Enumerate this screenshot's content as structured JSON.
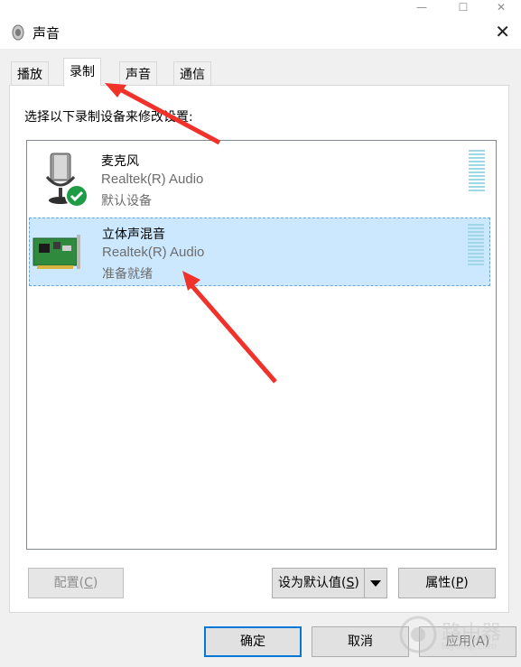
{
  "window": {
    "title": "声音",
    "controls": {
      "minimize": "—",
      "maximize": "☐",
      "close": "✕"
    }
  },
  "tabs": [
    {
      "label": "播放",
      "active": false
    },
    {
      "label": "录制",
      "active": true
    },
    {
      "label": "声音",
      "active": false
    },
    {
      "label": "通信",
      "active": false
    }
  ],
  "instruction": "选择以下录制设备来修改设置:",
  "devices": [
    {
      "name": "麦克风",
      "driver": "Realtek(R) Audio",
      "status": "默认设备",
      "icon": "microphone-icon",
      "badge": "check-icon",
      "selected": false
    },
    {
      "name": "立体声混音",
      "driver": "Realtek(R) Audio",
      "status": "准备就绪",
      "icon": "sound-card-icon",
      "selected": true
    }
  ],
  "buttons": {
    "configure": {
      "main": "配置(",
      "key": "C",
      "end": ")",
      "enabled": false
    },
    "set_default": {
      "main": "设为默认值(",
      "key": "S",
      "end": ")"
    },
    "properties": {
      "main": "属性(",
      "key": "P",
      "end": ")"
    },
    "ok": "确定",
    "cancel": "取消",
    "apply": "应用(A)"
  },
  "watermark": {
    "text": "路由器",
    "subtext": "luyouqi.com"
  },
  "colors": {
    "selection": "#cce8ff",
    "annotation_arrow": "#f0322b",
    "ok_border": "#0078d7"
  }
}
